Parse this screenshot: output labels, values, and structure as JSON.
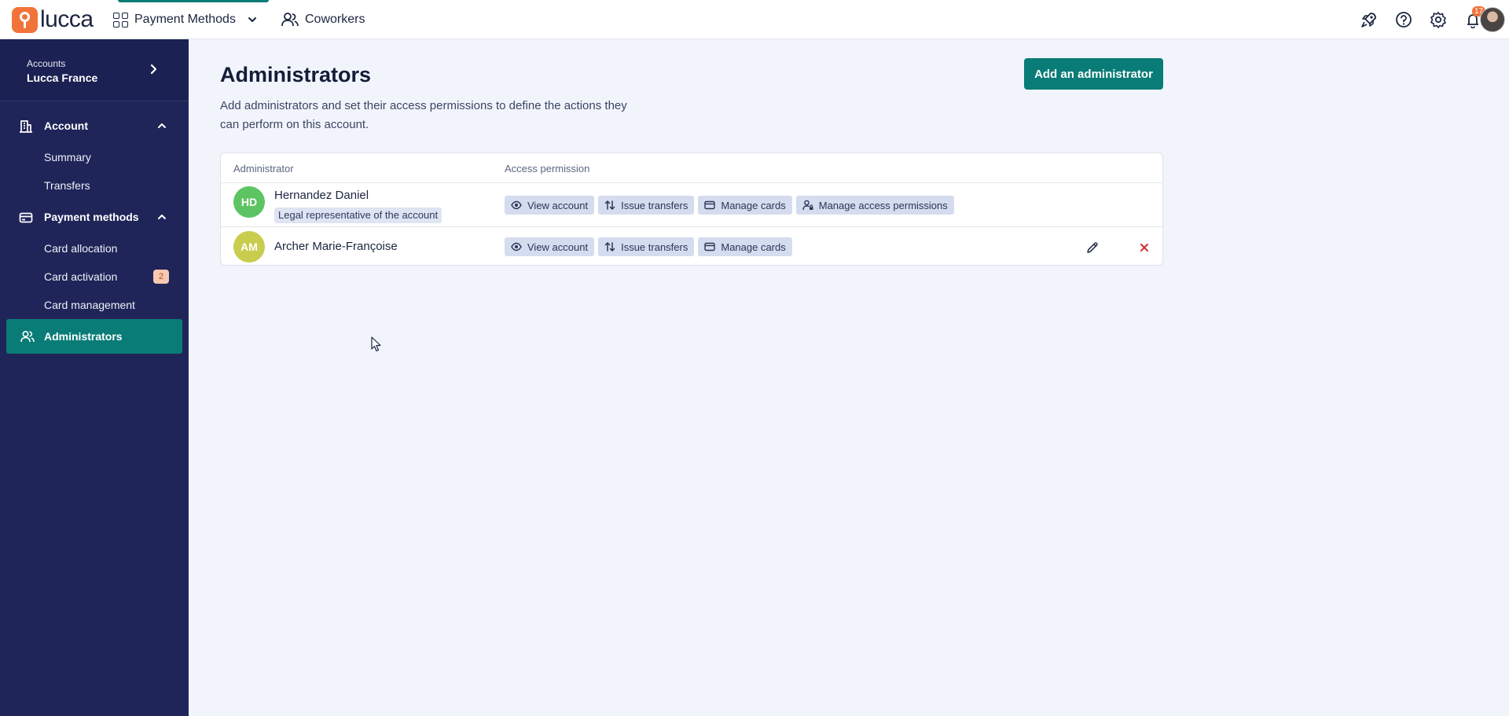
{
  "topbar": {
    "logo_text": "lucca",
    "tabs": [
      {
        "label": "Payment Methods",
        "active": true
      },
      {
        "label": "Coworkers",
        "active": false
      }
    ],
    "notifications_count": "17",
    "icons": [
      "rocket-icon",
      "help-icon",
      "settings-icon",
      "bell-icon",
      "user-avatar"
    ]
  },
  "sidebar": {
    "account_switcher": {
      "sublabel": "Accounts",
      "name": "Lucca France"
    },
    "sections": [
      {
        "label": "Account",
        "items": [
          "Summary",
          "Transfers"
        ]
      },
      {
        "label": "Payment methods",
        "items": [
          "Card allocation",
          "Card activation",
          "Card management"
        ]
      }
    ],
    "card_activation_badge": "2",
    "active_item": "Administrators"
  },
  "main": {
    "title": "Administrators",
    "description": "Add administrators and set their access permissions to define the actions they can perform on this account.",
    "add_button": "Add an administrator",
    "table": {
      "headers": [
        "Administrator",
        "Access permission"
      ],
      "rows": [
        {
          "initials": "HD",
          "name": "Hernandez Daniel",
          "tag": "Legal representative of the account",
          "avatar_color": "#5dc463",
          "permissions": [
            "View account",
            "Issue transfers",
            "Manage cards",
            "Manage access permissions"
          ]
        },
        {
          "initials": "AM",
          "name": "Archer Marie-Françoise",
          "tag": "",
          "avatar_color": "#c9cd4e",
          "permissions": [
            "View account",
            "Issue transfers",
            "Manage cards"
          ]
        }
      ]
    }
  },
  "colors": {
    "sidebar_bg": "#1f2559",
    "accent": "#0a7c77",
    "brand_orange": "#f2733a",
    "delete_red": "#d0312d"
  }
}
